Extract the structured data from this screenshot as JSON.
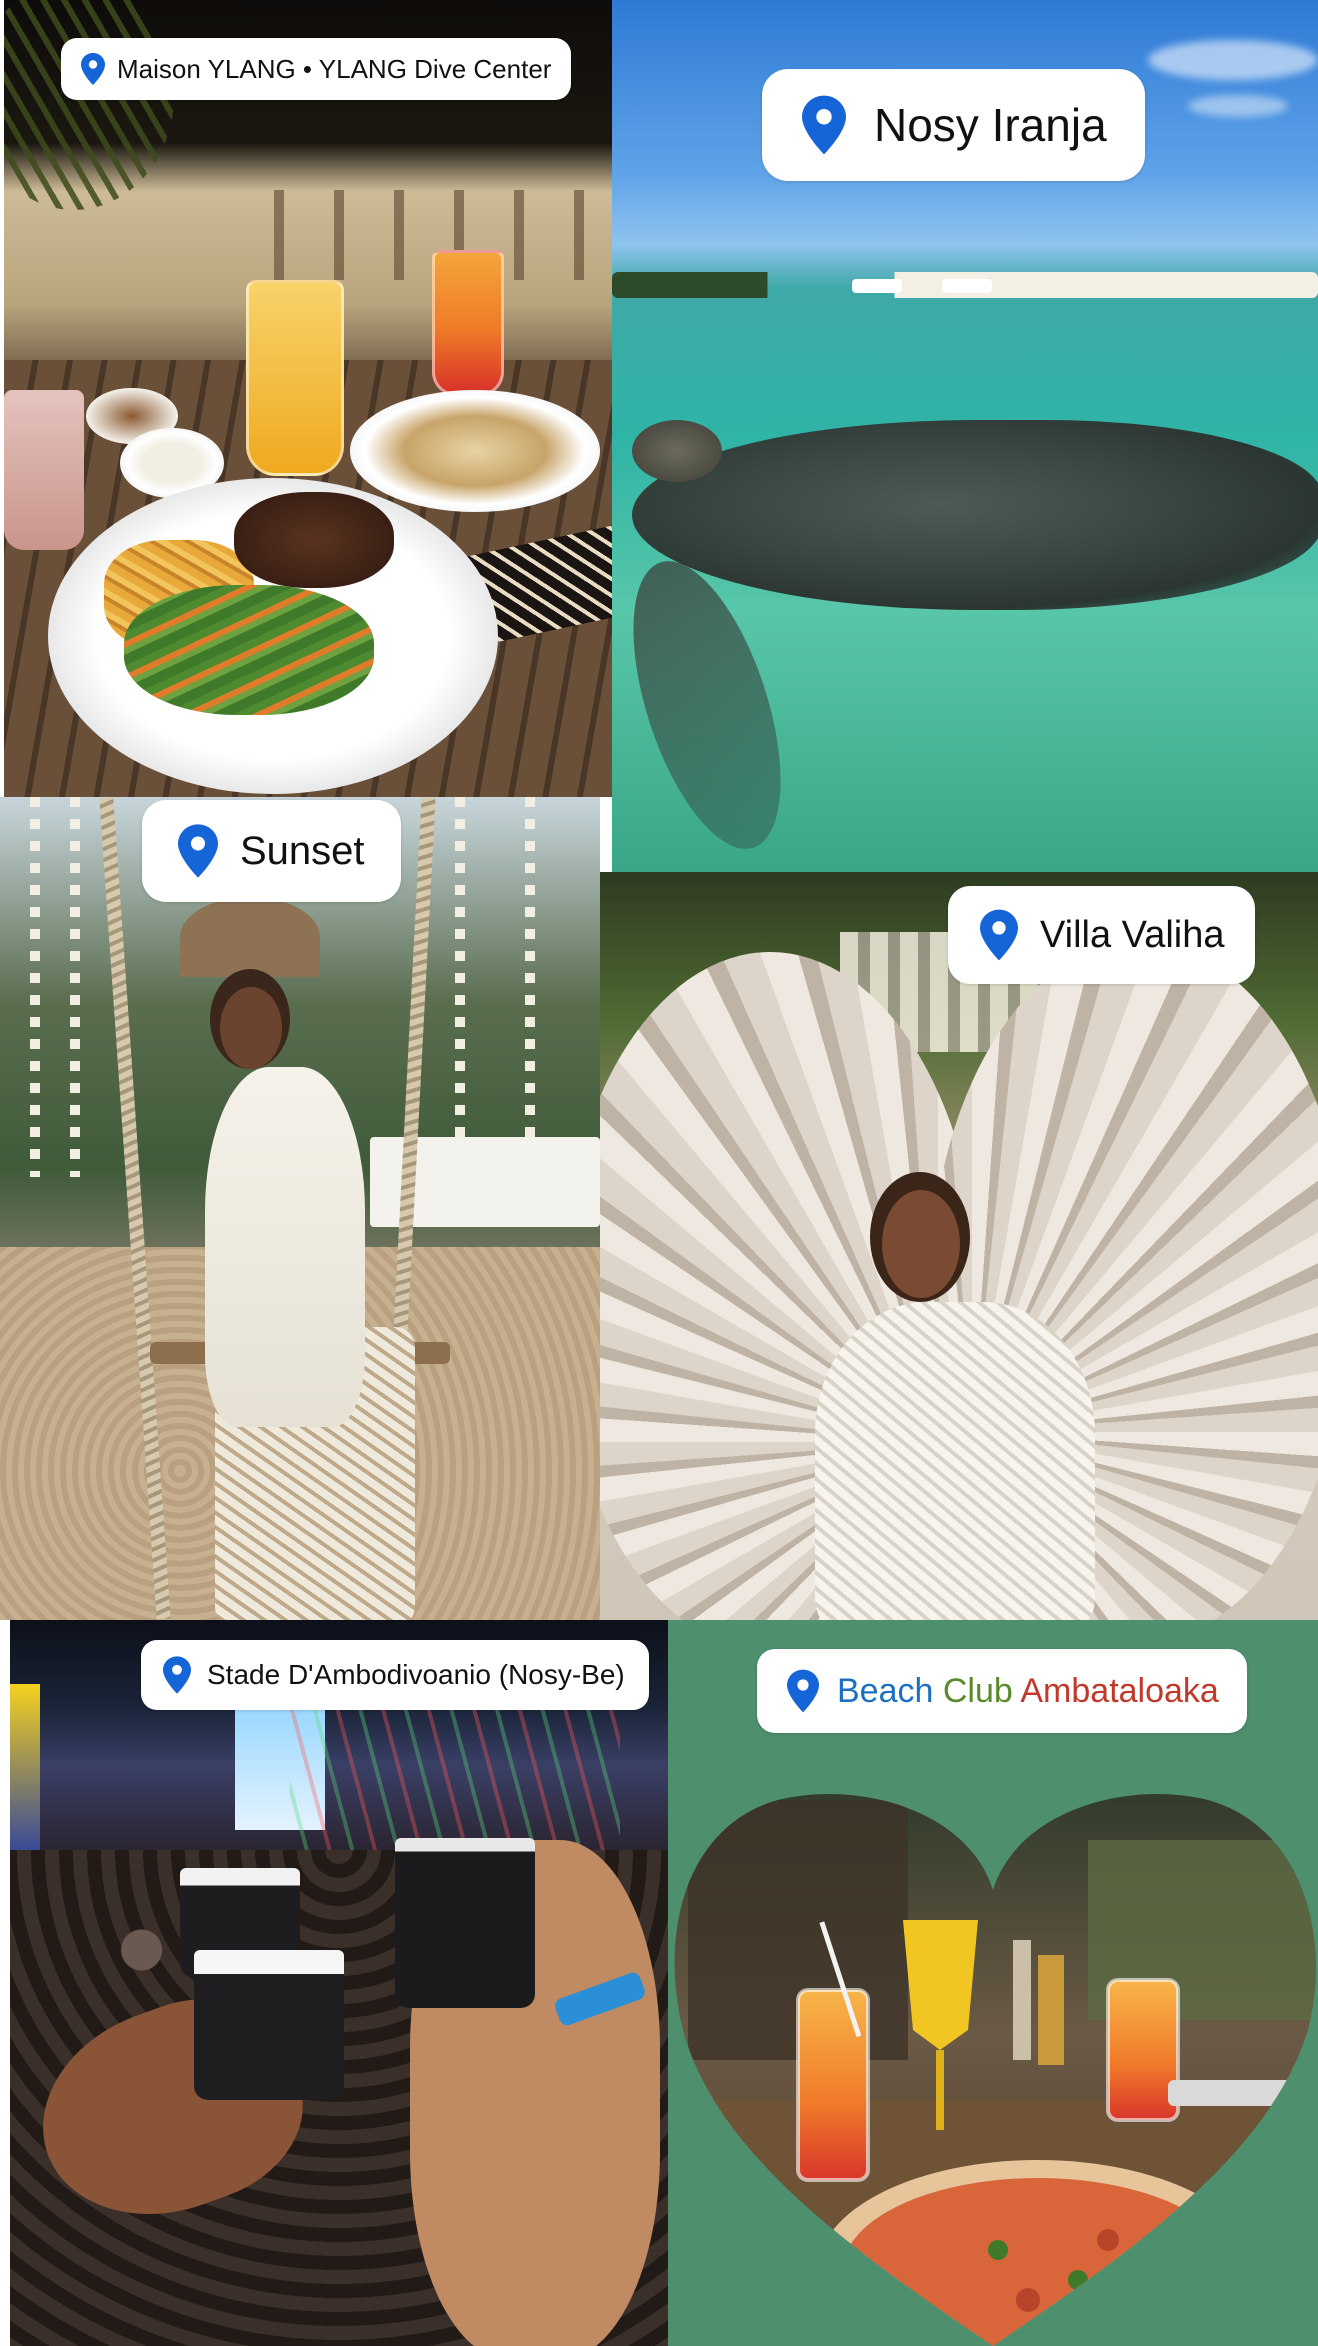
{
  "colors": {
    "pin": "#1565d8",
    "tag_background": "#ffffff",
    "beach_background": "#4e8f6e",
    "beach_word_blue": "#1d6fc4",
    "beach_word_green": "#5b8a2a",
    "beach_word_red": "#c0392b"
  },
  "icons": {
    "location": "map-pin-icon"
  },
  "tags": {
    "maison": "Maison YLANG • YLANG Dive Center",
    "iranja": "Nosy Iranja",
    "sunset": "Sunset",
    "villa": "Villa Valiha",
    "stade": "Stade D'Ambodivoanio (Nosy-Be)",
    "beach": {
      "word1": "Beach",
      "word2": "Club",
      "word3": "Ambataloaka"
    }
  }
}
